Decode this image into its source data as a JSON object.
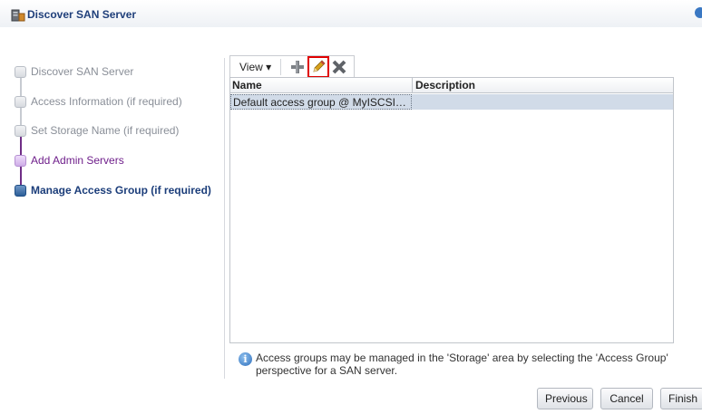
{
  "window": {
    "title": "Discover SAN Server"
  },
  "train": {
    "steps": [
      {
        "label": "Discover SAN Server",
        "state": "disabled"
      },
      {
        "label": "Access Information (if required)",
        "state": "disabled"
      },
      {
        "label": "Set Storage Name (if required)",
        "state": "disabled"
      },
      {
        "label": "Add Admin Servers",
        "state": "visited"
      },
      {
        "label": "Manage Access Group (if required)",
        "state": "current"
      }
    ]
  },
  "toolbar": {
    "view_label": "View ▾",
    "add_icon": "add-icon",
    "edit_icon": "edit-pencil-icon",
    "delete_icon": "delete-icon"
  },
  "table": {
    "columns": [
      "Name",
      "Description"
    ],
    "rows": [
      {
        "name": "Default access group @ MyISCSI…",
        "description": ""
      }
    ]
  },
  "info": {
    "text": "Access groups may be managed in the 'Storage' area by selecting the 'Access Group' perspective for a SAN server."
  },
  "footer": {
    "previous_label": "Previous",
    "cancel_label": "Cancel",
    "finish_label": "Finish"
  },
  "colors": {
    "accent": "#1f3f7a",
    "visited": "#6f1f8b",
    "selection": "#d1dbe8",
    "highlight": "#e00000"
  }
}
